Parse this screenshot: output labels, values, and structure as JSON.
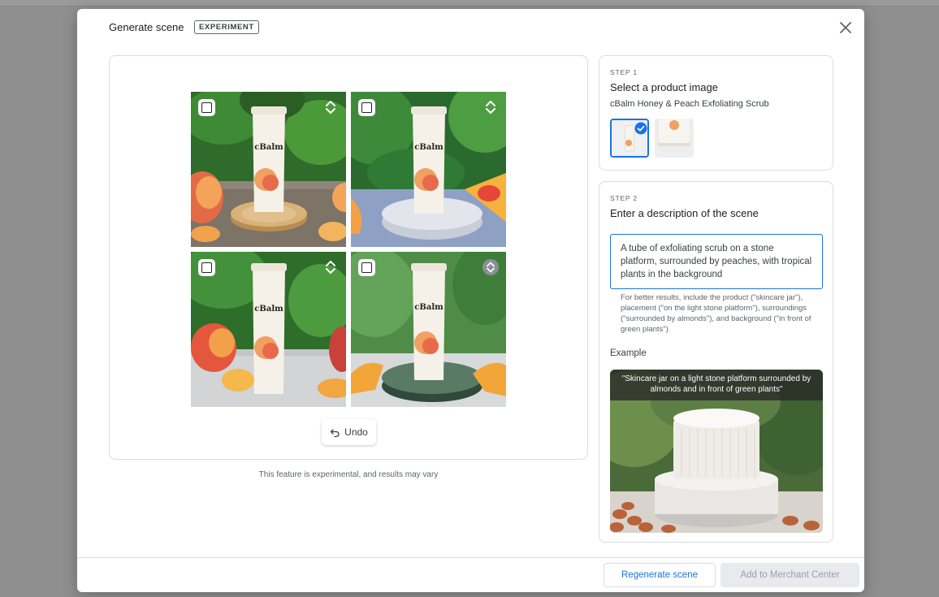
{
  "dialog": {
    "title": "Generate scene",
    "badge": "EXPERIMENT",
    "disclaimer": "This feature is experimental, and results may vary",
    "undo_label": "Undo"
  },
  "tiles": [
    {
      "brand": "cBalm",
      "selected": false
    },
    {
      "brand": "cBalm",
      "selected": false
    },
    {
      "brand": "cBalm",
      "selected": false
    },
    {
      "brand": "cBalm",
      "selected": false
    }
  ],
  "step1": {
    "step_label": "STEP 1",
    "title": "Select a product image",
    "product_name": "cBalm Honey & Peach Exfoliating Scrub"
  },
  "step2": {
    "step_label": "STEP 2",
    "title": "Enter a description of the scene",
    "description": "A tube of exfoliating scrub on a stone platform, surrounded by peaches, with tropical plants in the background",
    "hint": "For better results, include the product (\"skincare jar\"), placement (\"on the light stone platform\"), surroundings (\"surrounded by almonds\"), and background (\"in front of green plants\")",
    "example_label": "Example",
    "example_caption": "\"Skincare jar on a light stone platform surrounded by almonds and in front of green plants\""
  },
  "footer": {
    "regenerate_label": "Regenerate scene",
    "add_label": "Add to Merchant Center"
  },
  "colors": {
    "accent": "#1a73e8",
    "disabled_bg": "#e8eaed",
    "disabled_text": "#9aa0a6"
  }
}
